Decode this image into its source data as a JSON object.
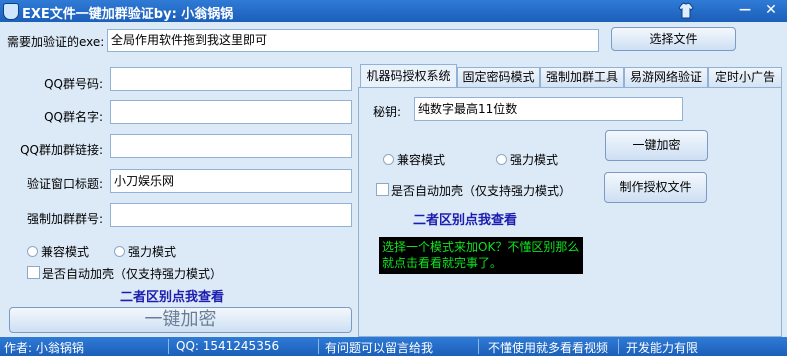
{
  "window": {
    "title": "EXE文件一键加群验证by: 小翁锅锅",
    "min_glyph": "—",
    "close_glyph": "✕"
  },
  "top": {
    "exe_label": "需要加验证的exe:",
    "exe_value": "全局作用软件拖到我这里即可",
    "select_file_button": "选择文件"
  },
  "left": {
    "qq_number_label": "QQ群号码:",
    "qq_name_label": "QQ群名字:",
    "qq_link_label": "QQ群加群链接:",
    "verify_title_label": "验证窗口标题:",
    "verify_title_value": "小刀娱乐网",
    "force_group_label": "强制加群群号:",
    "compat_mode_label": "兼容模式",
    "strong_mode_label": "强力模式",
    "auto_pack_label": "是否自动加壳（仅支持强力模式）",
    "difference_link": "二者区别点我查看",
    "one_key_encrypt_button": "一键加密"
  },
  "tabs": [
    {
      "label": "机器码授权系统"
    },
    {
      "label": "固定密码模式"
    },
    {
      "label": "强制加群工具"
    },
    {
      "label": "易游网络验证"
    },
    {
      "label": "定时小广告"
    }
  ],
  "right": {
    "secret_label": "秘钥:",
    "secret_value": "纯数字最高11位数",
    "one_key_encrypt_button": "一键加密",
    "compat_mode_label": "兼容模式",
    "strong_mode_label": "强力模式",
    "make_license_button": "制作授权文件",
    "auto_pack_label": "是否自动加壳（仅支持强力模式）",
    "difference_link": "二者区别点我查看",
    "console_text": "选择一个模式来加OK？不懂区别那么就点击看看就完事了。"
  },
  "status_bar": {
    "author": "作者:  小翁锅锅",
    "qq": "QQ:  1541245356",
    "message": "有问题可以留言给我",
    "video": "不懂使用就多看看视频",
    "dev": "开发能力有限"
  },
  "colors": {
    "title_bar": "#1f67c4",
    "window_bg": "#dce9f7",
    "link_blue": "#1d1daf",
    "console_bg": "#000000",
    "console_fg": "#10e020"
  }
}
